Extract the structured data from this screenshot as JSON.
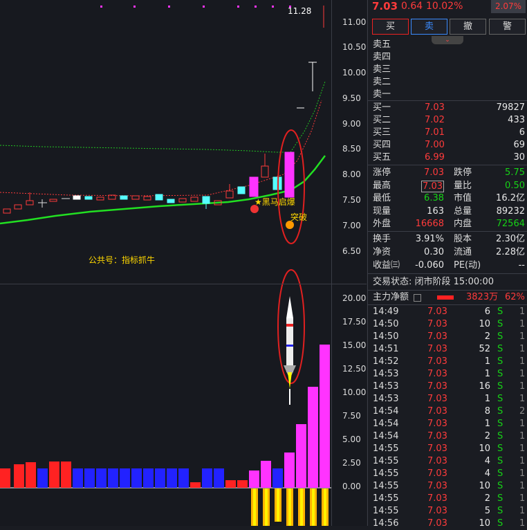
{
  "price_axis": [
    "11.00",
    "10.50",
    "10.00",
    "9.50",
    "9.00",
    "8.50",
    "8.00",
    "7.50",
    "7.00",
    "6.50"
  ],
  "vol_axis": [
    "20.00",
    "17.50",
    "15.00",
    "12.50",
    "10.00",
    "7.50",
    "5.00",
    "2.50",
    "0.00"
  ],
  "high_marker": "11.28",
  "annotations": {
    "promo": "公共号：指标抓牛",
    "signal1": "★黑马启爆",
    "signal2": "突破"
  },
  "quote": {
    "price": "7.03",
    "change": "0.64",
    "change_pct": "10.02%",
    "badge": "2.07%"
  },
  "buttons": {
    "buy": "买",
    "sell": "卖",
    "cancel": "撤",
    "alert": "警"
  },
  "ask_labels": [
    "卖五",
    "卖四",
    "卖三",
    "卖二",
    "卖一"
  ],
  "bids": [
    {
      "label": "买一",
      "price": "7.03",
      "vol": "79827"
    },
    {
      "label": "买二",
      "price": "7.02",
      "vol": "433"
    },
    {
      "label": "买三",
      "price": "7.01",
      "vol": "6"
    },
    {
      "label": "买四",
      "price": "7.00",
      "vol": "69"
    },
    {
      "label": "买五",
      "price": "6.99",
      "vol": "30"
    }
  ],
  "stats": [
    {
      "l1": "涨停",
      "v1": "7.03",
      "c1": "red",
      "l2": "跌停",
      "v2": "5.75",
      "c2": "green"
    },
    {
      "l1": "最高",
      "v1": "7.03",
      "c1": "red",
      "l2": "量比",
      "v2": "0.50",
      "c2": "green"
    },
    {
      "l1": "最低",
      "v1": "6.38",
      "c1": "green",
      "l2": "市值",
      "v2": "16.2亿",
      "c2": "white"
    },
    {
      "l1": "现量",
      "v1": "163",
      "c1": "white",
      "l2": "总量",
      "v2": "89232",
      "c2": "white"
    },
    {
      "l1": "外盘",
      "v1": "16668",
      "c1": "red",
      "l2": "内盘",
      "v2": "72564",
      "c2": "green"
    }
  ],
  "stats2": [
    {
      "l1": "换手",
      "v1": "3.91%",
      "l2": "股本",
      "v2": "2.30亿"
    },
    {
      "l1": "净资",
      "v1": "0.30",
      "l2": "流通",
      "v2": "2.28亿"
    },
    {
      "l1": "收益㈢",
      "v1": "-0.060",
      "l2": "PE(动)",
      "v2": "--"
    }
  ],
  "trade_status": "交易状态: 闭市阶段 15:00:00",
  "main_flow": {
    "label": "主力净额",
    "value": "3823万",
    "pct": "62%"
  },
  "ticks": [
    {
      "t": "14:49",
      "p": "7.03",
      "v": "6",
      "s": "S",
      "n": "1"
    },
    {
      "t": "14:50",
      "p": "7.03",
      "v": "10",
      "s": "S",
      "n": "1"
    },
    {
      "t": "14:50",
      "p": "7.03",
      "v": "2",
      "s": "S",
      "n": "1"
    },
    {
      "t": "14:51",
      "p": "7.03",
      "v": "52",
      "s": "S",
      "n": "1"
    },
    {
      "t": "14:52",
      "p": "7.03",
      "v": "1",
      "s": "S",
      "n": "1"
    },
    {
      "t": "14:53",
      "p": "7.03",
      "v": "1",
      "s": "S",
      "n": "1"
    },
    {
      "t": "14:53",
      "p": "7.03",
      "v": "16",
      "s": "S",
      "n": "1"
    },
    {
      "t": "14:53",
      "p": "7.03",
      "v": "1",
      "s": "S",
      "n": "1"
    },
    {
      "t": "14:54",
      "p": "7.03",
      "v": "8",
      "s": "S",
      "n": "2"
    },
    {
      "t": "14:54",
      "p": "7.03",
      "v": "1",
      "s": "S",
      "n": "1"
    },
    {
      "t": "14:54",
      "p": "7.03",
      "v": "2",
      "s": "S",
      "n": "1"
    },
    {
      "t": "14:55",
      "p": "7.03",
      "v": "10",
      "s": "S",
      "n": "1"
    },
    {
      "t": "14:55",
      "p": "7.03",
      "v": "4",
      "s": "S",
      "n": "1"
    },
    {
      "t": "14:55",
      "p": "7.03",
      "v": "4",
      "s": "S",
      "n": "1"
    },
    {
      "t": "14:55",
      "p": "7.03",
      "v": "10",
      "s": "S",
      "n": "1"
    },
    {
      "t": "14:55",
      "p": "7.03",
      "v": "2",
      "s": "S",
      "n": "1"
    },
    {
      "t": "14:55",
      "p": "7.03",
      "v": "5",
      "s": "S",
      "n": "1"
    },
    {
      "t": "14:56",
      "p": "7.03",
      "v": "10",
      "s": "S",
      "n": "1"
    }
  ]
}
